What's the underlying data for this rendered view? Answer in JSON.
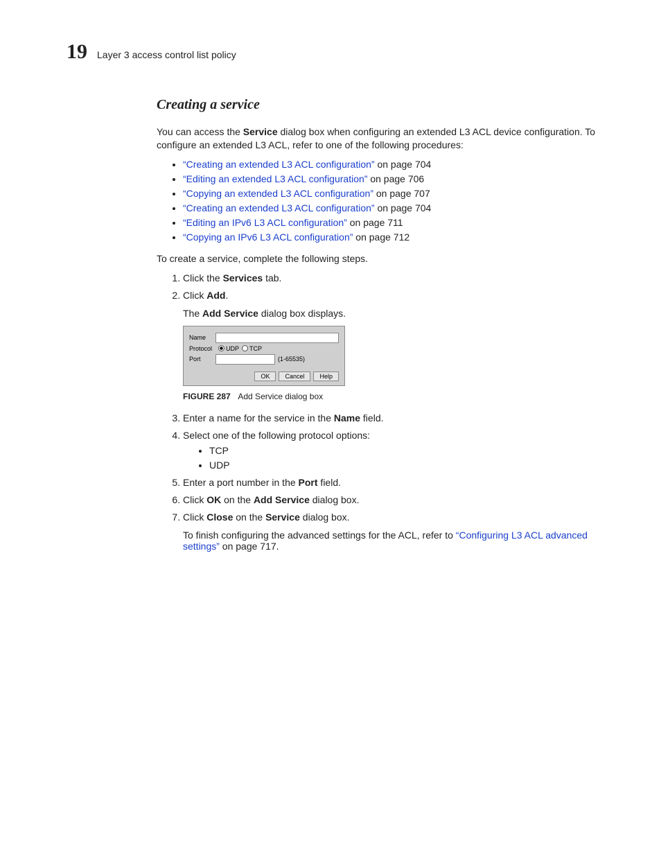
{
  "header": {
    "chapter_number": "19",
    "chapter_title": "Layer 3 access control list policy"
  },
  "section_title": "Creating a service",
  "intro_full": "You can access the Service dialog box when configuring an extended L3 ACL device configuration. To configure an extended L3 ACL, refer to one of the following procedures:",
  "intro_pre": "You can access the ",
  "intro_bold1": "Service",
  "intro_post": " dialog box when configuring an extended L3 ACL device configuration. To configure an extended L3 ACL, refer to one of the following procedures:",
  "xrefs": [
    {
      "title": "“Creating an extended L3 ACL configuration”",
      "suffix": " on page 704"
    },
    {
      "title": "“Editing an extended L3 ACL configuration”",
      "suffix": " on page 706"
    },
    {
      "title": "“Copying an extended L3 ACL configuration”",
      "suffix": " on page 707"
    },
    {
      "title": "“Creating an extended L3 ACL configuration”",
      "suffix": " on page 704"
    },
    {
      "title": "“Editing an IPv6 L3 ACL configuration”",
      "suffix": " on page 711"
    },
    {
      "title": "“Copying an IPv6 L3 ACL configuration”",
      "suffix": " on page 712"
    }
  ],
  "lead_in": "To create a service, complete the following steps.",
  "step1_pre": "Click the ",
  "step1_bold": "Services",
  "step1_post": " tab.",
  "step2_pre": "Click ",
  "step2_bold": "Add",
  "step2_post": ".",
  "step2_sub_pre": "The ",
  "step2_sub_bold": "Add Service",
  "step2_sub_post": " dialog box displays.",
  "dialog": {
    "name_label": "Name",
    "protocol_label": "Protocol",
    "udp_label": "UDP",
    "tcp_label": "TCP",
    "port_label": "Port",
    "port_hint": "(1-65535)",
    "ok": "OK",
    "cancel": "Cancel",
    "help": "Help"
  },
  "figure": {
    "label": "FIGURE 287",
    "caption": "Add Service dialog box"
  },
  "step3_pre": "Enter a name for the service in the ",
  "step3_bold": "Name",
  "step3_post": " field.",
  "step4_text": "Select one of the following protocol options:",
  "step4_opts": [
    "TCP",
    "UDP"
  ],
  "step5_pre": "Enter a port number in the ",
  "step5_bold": "Port",
  "step5_post": " field.",
  "step6_pre": "Click ",
  "step6_bold1": "OK",
  "step6_mid": " on the ",
  "step6_bold2": "Add Service",
  "step6_post": " dialog box.",
  "step7_pre": "Click ",
  "step7_bold1": "Close",
  "step7_mid": " on the ",
  "step7_bold2": "Service",
  "step7_post": " dialog box.",
  "step7_sub_pre": "To finish configuring the advanced settings for the ACL, refer to ",
  "step7_sub_link": "“Configuring L3 ACL advanced settings”",
  "step7_sub_post": " on page 717."
}
